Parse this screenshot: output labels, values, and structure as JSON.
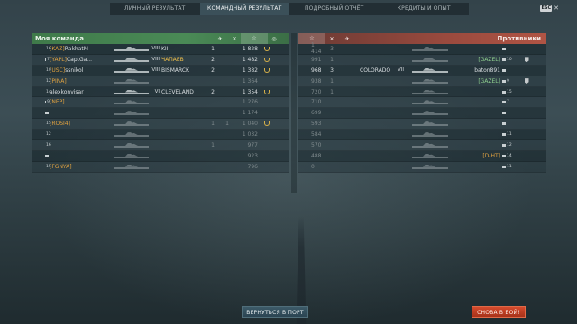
{
  "tabs": [
    {
      "label": "ЛИЧНЫЙ РЕЗУЛЬТАТ",
      "active": false
    },
    {
      "label": "КОМАНДНЫЙ РЕЗУЛЬТАТ",
      "active": true
    },
    {
      "label": "ПОДРОБНЫЙ ОТЧЁТ",
      "active": false
    },
    {
      "label": "КРЕДИТЫ И ОПЫТ",
      "active": false
    }
  ],
  "esc": {
    "key": "ESC",
    "icon": "close-icon"
  },
  "my_team": {
    "title": "Моя команда",
    "columns": [
      "plane-icon",
      "cross-icon",
      "star-icon",
      "wreath-icon"
    ],
    "rows": [
      {
        "level": "16",
        "clan": "[KAZ]",
        "name": "RakhatM",
        "tier": "VIII",
        "ship": "KII",
        "c1": "1",
        "c2": "",
        "score": "1 828",
        "wreath": true
      },
      {
        "level": "7",
        "clan": "[YAPL]",
        "name": "CaptGa...",
        "tier": "VIII",
        "ship": "ЧАПАЕВ",
        "c1": "2",
        "c2": "",
        "score": "1 482",
        "wreath": true
      },
      {
        "level": "10",
        "clan": "[USC]",
        "name": "ssnikol",
        "tier": "VIII",
        "ship": "BISMARCK",
        "c1": "2",
        "c2": "",
        "score": "1 382",
        "wreath": true
      },
      {
        "level": "12",
        "clan": "[PINA]",
        "name": "",
        "tier": "",
        "ship": "",
        "c1": "",
        "c2": "",
        "score": "1 364",
        "wreath": false
      },
      {
        "level": "14",
        "clan": "",
        "name": "alexkonvisar",
        "tier": "VI",
        "ship": "CLEVELAND",
        "c1": "2",
        "c2": "",
        "score": "1 354",
        "wreath": true
      },
      {
        "level": "9",
        "clan": "[NEP]",
        "name": "",
        "tier": "",
        "ship": "",
        "c1": "",
        "c2": "",
        "score": "1 276",
        "wreath": false
      },
      {
        "level": "",
        "clan": "",
        "name": "",
        "tier": "",
        "ship": "",
        "c1": "",
        "c2": "",
        "score": "1 174",
        "wreath": false
      },
      {
        "level": "15",
        "clan": "[ROSI4]",
        "name": "",
        "tier": "",
        "ship": "",
        "c1": "1",
        "c2": "1",
        "score": "1 040",
        "wreath": true
      },
      {
        "level": "12",
        "clan": "",
        "name": "",
        "tier": "",
        "ship": "",
        "c1": "",
        "c2": "",
        "score": "1 032",
        "wreath": false
      },
      {
        "level": "16",
        "clan": "",
        "name": "",
        "tier": "",
        "ship": "",
        "c1": "1",
        "c2": "",
        "score": "977",
        "wreath": false
      },
      {
        "level": "",
        "clan": "",
        "name": "",
        "tier": "",
        "ship": "",
        "c1": "",
        "c2": "",
        "score": "923",
        "wreath": false
      },
      {
        "level": "15",
        "clan": "[FGNYA]",
        "name": "",
        "tier": "",
        "ship": "",
        "c1": "",
        "c2": "",
        "score": "796",
        "wreath": false
      }
    ]
  },
  "enemy_team": {
    "title": "Противники",
    "rows": [
      {
        "score": "1 414",
        "c2": "3",
        "c1": "",
        "ship": "",
        "tier": "",
        "name": "",
        "level": ""
      },
      {
        "score": "991",
        "c2": "1",
        "c1": "",
        "ship": "",
        "tier": "",
        "name": "[GAZEL]",
        "level": "10"
      },
      {
        "score": "968",
        "c2": "3",
        "c1": "",
        "ship": "COLORADO",
        "tier": "VII",
        "name": "baton891",
        "level": ""
      },
      {
        "score": "938",
        "c2": "1",
        "c1": "",
        "ship": "",
        "tier": "",
        "name": "[GAZEL]",
        "level": "9"
      },
      {
        "score": "720",
        "c2": "1",
        "c1": "",
        "ship": "",
        "tier": "",
        "name": "",
        "level": "15"
      },
      {
        "score": "710",
        "c2": "",
        "c1": "",
        "ship": "",
        "tier": "",
        "name": "",
        "level": "7"
      },
      {
        "score": "699",
        "c2": "",
        "c1": "",
        "ship": "",
        "tier": "",
        "name": "",
        "level": ""
      },
      {
        "score": "593",
        "c2": "",
        "c1": "",
        "ship": "",
        "tier": "",
        "name": "",
        "level": ""
      },
      {
        "score": "584",
        "c2": "",
        "c1": "",
        "ship": "",
        "tier": "",
        "name": "",
        "level": "11"
      },
      {
        "score": "570",
        "c2": "",
        "c1": "",
        "ship": "",
        "tier": "",
        "name": "",
        "level": "12"
      },
      {
        "score": "488",
        "c2": "",
        "c1": "",
        "ship": "",
        "tier": "",
        "name": "[D-HT]",
        "level": "14"
      },
      {
        "score": "0",
        "c2": "",
        "c1": "",
        "ship": "",
        "tier": "",
        "name": "",
        "level": "11"
      }
    ]
  },
  "buttons": {
    "port": "ВЕРНУТЬСЯ В ПОРТ",
    "again": "СНОВА В БОЙ!"
  }
}
